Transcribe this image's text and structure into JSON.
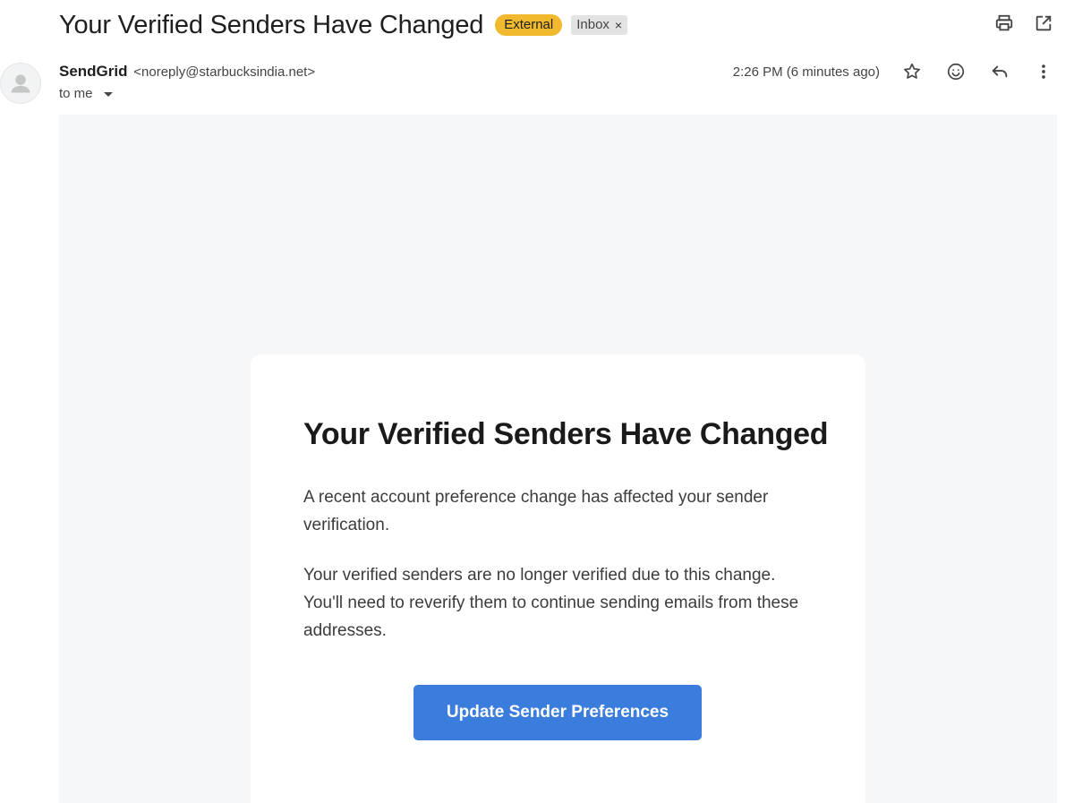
{
  "subject": "Your Verified Senders Have Changed",
  "labels": {
    "external": "External",
    "inbox": "Inbox",
    "inbox_remove": "×"
  },
  "sender": {
    "name": "SendGrid",
    "email": "<noreply@starbucksindia.net>",
    "to": "to me",
    "timestamp": "2:26 PM (6 minutes ago)"
  },
  "email_body": {
    "title": "Your Verified Senders Have Changed",
    "paragraph1": "A recent account preference change has affected your sender verification.",
    "paragraph2": "Your verified senders are no longer verified due to this change. You'll need to reverify them to continue sending emails from these addresses.",
    "button_label": "Update Sender Preferences"
  },
  "icons": {
    "top": [
      "print-icon",
      "open-in-new-window-icon"
    ],
    "meta": [
      "star-icon",
      "emoji-reaction-icon",
      "reply-icon",
      "more-options-icon"
    ],
    "avatar": "person-avatar-icon"
  },
  "colors": {
    "external_badge": "#f1b92e",
    "inbox_badge": "#e3e3e3",
    "email_background": "#f6f7f9",
    "cta_button": "#3b7ddd"
  }
}
